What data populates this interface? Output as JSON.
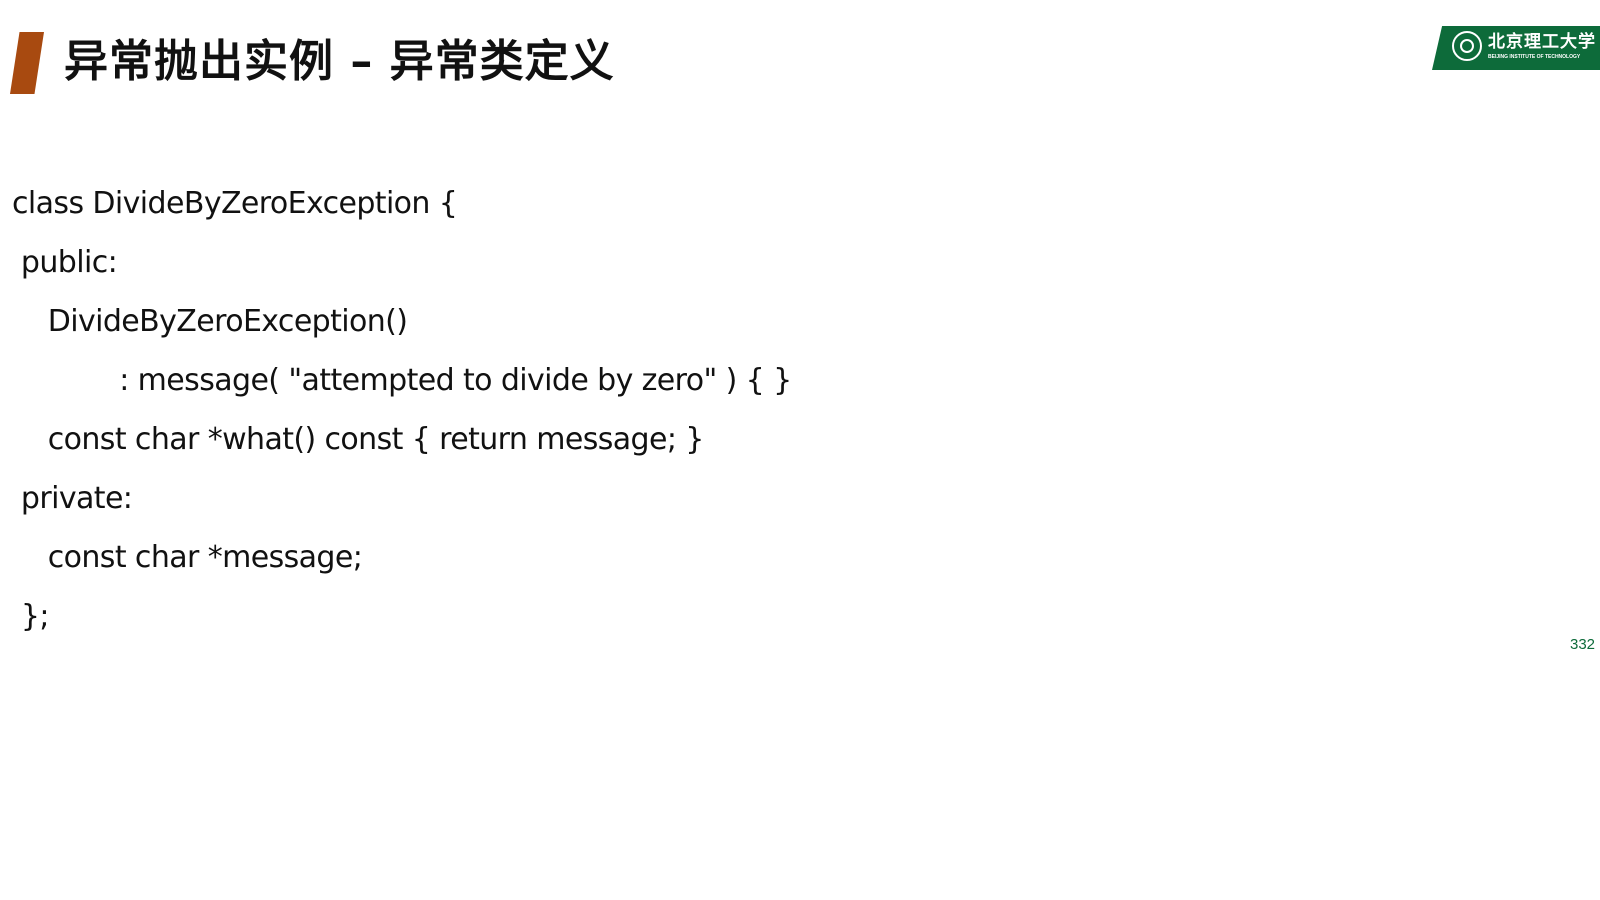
{
  "slide": {
    "title": "异常抛出实例 – 异常类定义",
    "logo": {
      "name": "北京理工大学",
      "subtitle": "BEIJING INSTITUTE OF TECHNOLOGY"
    },
    "code_lines": [
      "class DivideByZeroException {",
      " public:",
      "    DivideByZeroException()",
      "            : message( \"attempted to divide by zero\" ) { }",
      "    const char *what() const { return message; }",
      " private:",
      "    const char *message;",
      " };"
    ],
    "page_number": "332"
  },
  "colors": {
    "title_accent": "#a84a10",
    "logo_green": "#0d6b3a",
    "text": "#111111"
  }
}
